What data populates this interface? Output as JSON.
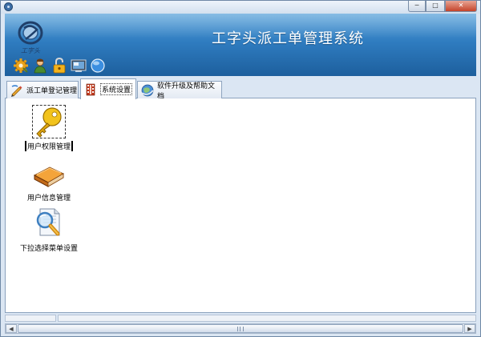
{
  "window": {
    "controls": {
      "minimize": "─",
      "maximize": "□",
      "close": "✕"
    }
  },
  "banner": {
    "title": "工字头派工单管理系统",
    "logo_icon": "company-logo",
    "quick_tools": [
      "gear-icon",
      "user-icon",
      "lock-icon",
      "screen-icon",
      "globe-icon"
    ]
  },
  "tabs": [
    {
      "label": "派工单登记管理",
      "icon": "edit-icon",
      "active": false
    },
    {
      "label": "系统设置",
      "icon": "film-settings-icon",
      "active": true
    },
    {
      "label": "软件升级及帮助文档",
      "icon": "globe-arrow-icon",
      "active": false
    }
  ],
  "content": {
    "items": [
      {
        "label": "用户权限管理",
        "icon": "key-icon",
        "selected": true
      },
      {
        "label": "用户信息管理",
        "icon": "book-icon",
        "selected": false
      },
      {
        "label": "下拉选择菜单设置",
        "icon": "magnifier-document-icon",
        "selected": false
      }
    ]
  },
  "scrollbar": {
    "left_arrow": "◀",
    "right_arrow": "▶"
  },
  "colors": {
    "banner_top": "#5fa6dc",
    "banner_bottom": "#1d5f9d",
    "frame": "#dbe6f3"
  }
}
